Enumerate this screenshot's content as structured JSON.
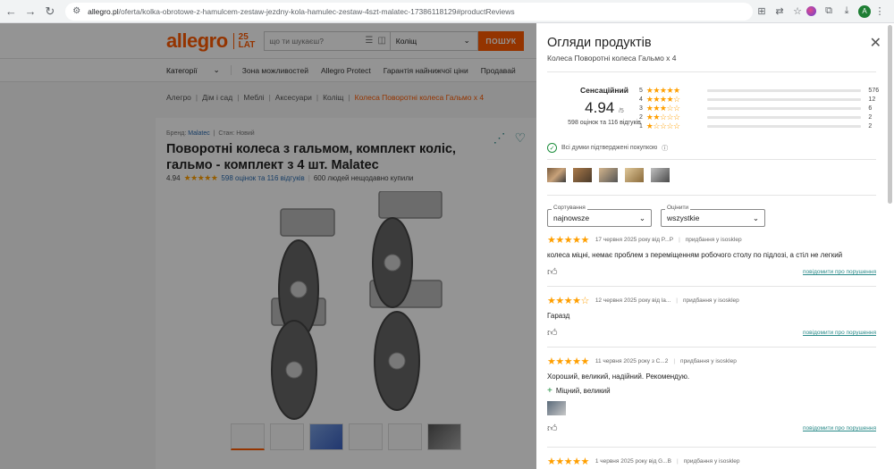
{
  "browser": {
    "url_domain": "allegro.pl",
    "url_path": "/oferta/kolka-obrotowe-z-hamulcem-zestaw-jezdny-kola-hamulec-zestaw-4szt-malatec-17386118129#productReviews",
    "profile_initial": "A"
  },
  "header": {
    "logo": "allegro",
    "logo_badge_top": "25",
    "logo_badge_bottom": "LAT",
    "search_placeholder": "що ти шукаєш?",
    "category_value": "Коліщ",
    "search_button": "ПОШУК"
  },
  "navbar": {
    "categories": "Категорії",
    "items": [
      "Зона можливостей",
      "Allegro Protect",
      "Гарантія найнижчої ціни",
      "Продавай"
    ]
  },
  "breadcrumbs": [
    "Алегро",
    "Дім і сад",
    "Меблі",
    "Аксесуари",
    "Коліщ",
    "Колеса Поворотні колеса Гальмо х 4"
  ],
  "product": {
    "brand_label": "Бренд:",
    "brand": "Malatec",
    "condition_label": "Стан:",
    "condition": "Новий",
    "title": "Поворотні колеса з гальмом, комплект коліс, гальмо - комплект з 4 шт. Malatec",
    "rating": "4.94",
    "stars": "★★★★★",
    "ratings_link": "598 оцінок та 116 відгуків",
    "bought": "600 людей нещодавно купили"
  },
  "panel": {
    "title": "Огляди продуктів",
    "subtitle": "Колеса Поворотні колеса Гальмо х 4",
    "summary_label": "Сенсаційний",
    "score": "4.94",
    "score_max": "/5",
    "counts": "598 оцінок та 116 відгуків",
    "verified": "Всі думки підтверджені покупкою",
    "distribution": [
      {
        "stars": "5",
        "glyphs": "★★★★★",
        "count": "576",
        "fraction": 0.963
      },
      {
        "stars": "4",
        "glyphs": "★★★★☆",
        "count": "12",
        "fraction": 0.02
      },
      {
        "stars": "3",
        "glyphs": "★★★☆☆",
        "count": "6",
        "fraction": 0.01
      },
      {
        "stars": "2",
        "glyphs": "★★☆☆☆",
        "count": "2",
        "fraction": 0.0
      },
      {
        "stars": "1",
        "glyphs": "★☆☆☆☆",
        "count": "2",
        "fraction": 0.0
      }
    ],
    "sort_label": "Сортування",
    "sort_value": "najnowsze",
    "rating_filter_label": "Оцінити",
    "rating_filter_value": "wszystkie",
    "reviews": [
      {
        "stars": "★★★★★",
        "date": "17 червня 2025 року від P...P",
        "source": "придбання у isosklep",
        "text": "колеса міцні, немає проблем з переміщенням робочого столу по підлозі, а стіл не легкий",
        "report": "повідомити про порушення"
      },
      {
        "stars": "★★★★☆",
        "date": "12 червня 2025 року від la...",
        "source": "придбання у isosklep",
        "text": "Гаразд",
        "report": "повідомити про порушення"
      },
      {
        "stars": "★★★★★",
        "date": "11 червня 2025 року з C...2",
        "source": "придбання у isosklep",
        "text": "Хороший, великий, надійний. Рекомендую.",
        "pros": "Міцний, великий",
        "report": "повідомити про порушення"
      },
      {
        "stars": "★★★★★",
        "date": "1 червня 2025 року від G...B",
        "source": "придбання у isosklep"
      }
    ]
  }
}
